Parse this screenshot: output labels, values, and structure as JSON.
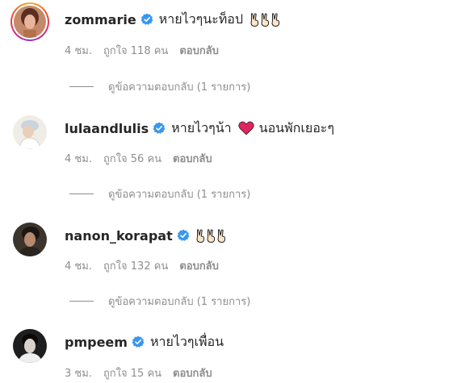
{
  "comments": [
    {
      "username": "zommarie",
      "text": "หายไวๆนะท็อป",
      "emoji": "victory-hand-x3",
      "time": "4 ชม.",
      "likes": "ถูกใจ 118 คน",
      "reply": "ตอบกลับ",
      "view_replies": "ดูข้อความตอบกลับ (1 รายการ)",
      "has_story_ring": true
    },
    {
      "username": "lulaandlulis",
      "text": "หายไวๆน้า",
      "text_after": "นอนพักเยอะๆ",
      "emoji": "red-heart",
      "time": "4 ชม.",
      "likes": "ถูกใจ 56 คน",
      "reply": "ตอบกลับ",
      "view_replies": "ดูข้อความตอบกลับ (1 รายการ)"
    },
    {
      "username": "nanon_korapat",
      "text": "",
      "emoji": "victory-hand-x3",
      "time": "4 ชม.",
      "likes": "ถูกใจ 132 คน",
      "reply": "ตอบกลับ",
      "view_replies": "ดูข้อความตอบกลับ (1 รายการ)"
    },
    {
      "username": "pmpeem",
      "text": "หายไวๆเพื่อน",
      "time": "3 ชม.",
      "likes": "ถูกใจ 15 คน",
      "reply": "ตอบกลับ"
    }
  ],
  "colors": {
    "verified_blue": "#3897f0",
    "meta_gray": "#8e8e8e",
    "text": "#262626",
    "heart_red": "#e0245e"
  }
}
